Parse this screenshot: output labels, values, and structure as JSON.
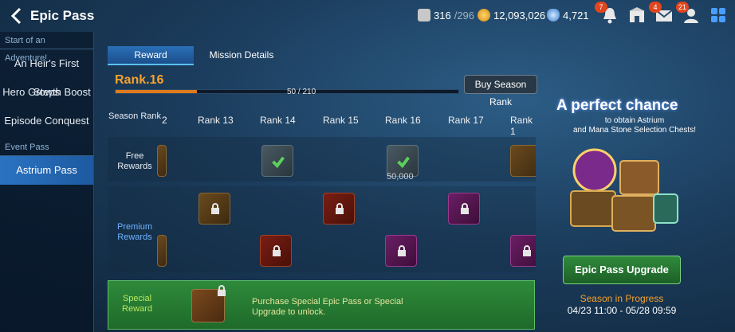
{
  "header": {
    "title": "Epic Pass",
    "stamina": "316",
    "stamina_max": "/296",
    "gold": "12,093,026",
    "crystals": "4,721",
    "badges": {
      "notifications": "7",
      "mail": "4",
      "friends": "21"
    }
  },
  "sidebar": {
    "section1": "Start of an Adventure!",
    "items1": [
      "An Heir's First Steps",
      "Hero Growth Boost",
      "Episode Conquest"
    ],
    "section2": "Event Pass",
    "items2": [
      "Astrium Pass"
    ]
  },
  "tabs": [
    "Reward",
    "Mission Details"
  ],
  "rank": {
    "label": "Rank.16",
    "progress_text": "50 / 210",
    "progress_fraction": 0.238,
    "buy_label": "Buy Season Rank"
  },
  "grid": {
    "season_rank_label": "Season Rank",
    "free_label": "Free Rewards",
    "premium_label": "Premium Rewards",
    "ranks": [
      "2",
      "Rank 13",
      "Rank 14",
      "Rank 15",
      "Rank 16",
      "Rank 17",
      "Rank 1"
    ],
    "free_value": "50,000"
  },
  "special": {
    "label": "Special Reward",
    "text": "Purchase Special Epic Pass or Special Upgrade to unlock."
  },
  "promo": {
    "title": "A perfect chance",
    "subtitle_line1": "to obtain Astrium",
    "subtitle_line2": "and Mana Stone Selection Chests!",
    "upgrade_label": "Epic Pass Upgrade",
    "status": "Season in Progress",
    "dates": "04/23 11:00 - 05/28 09:59"
  },
  "colors": {
    "accent": "#f7a22b",
    "active_tab": "#2a6fb8",
    "special_green": "#2e8a3a"
  }
}
